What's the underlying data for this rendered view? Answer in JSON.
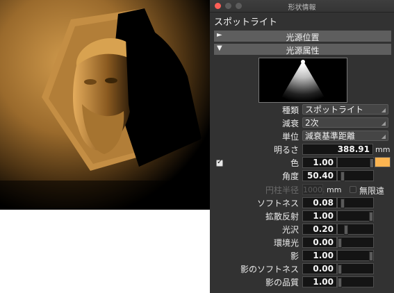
{
  "window": {
    "title": "形状情報"
  },
  "panel": {
    "heading": "スポットライト",
    "sections": [
      {
        "label": "光源位置",
        "state": "collapsed",
        "arrow": "►"
      },
      {
        "label": "光源属性",
        "state": "expanded",
        "arrow": "▼"
      }
    ]
  },
  "fields": {
    "type": {
      "label": "種類",
      "value": "スポットライト"
    },
    "attenuation": {
      "label": "減衰",
      "value": "2次"
    },
    "unit": {
      "label": "単位",
      "value": "減衰基準距離"
    },
    "brightness": {
      "label": "明るさ",
      "value": "388.91",
      "unit": "mm"
    },
    "color": {
      "label": "色",
      "value": "1.00",
      "checked": true,
      "swatch": "#fbb451"
    },
    "angle": {
      "label": "角度",
      "value": "50.40",
      "slider": 0.08
    },
    "cylinder_radius": {
      "label": "円柱半径",
      "value": "1000.",
      "unit": "mm",
      "infinite_label": "無限遠",
      "enabled": false
    },
    "softness": {
      "label": "ソフトネス",
      "value": "0.08",
      "slider": 0.08
    },
    "diffuse": {
      "label": "拡散反射",
      "value": "1.00",
      "slider": 1.0
    },
    "gloss": {
      "label": "光沢",
      "value": "0.20",
      "slider": 0.2
    },
    "ambient": {
      "label": "環境光",
      "value": "0.00",
      "slider": 0.0
    },
    "shadow": {
      "label": "影",
      "value": "1.00",
      "slider": 1.0
    },
    "shadow_softness": {
      "label": "影のソフトネス",
      "value": "0.00",
      "slider": 0.0
    },
    "shadow_quality": {
      "label": "影の品質",
      "value": "1.00",
      "slider": 0.0
    }
  },
  "colors": {
    "panel_bg": "#323232",
    "section_bg": "#5e5e5e",
    "accent_swatch": "#fbb451",
    "close_button": "#fe5f57"
  },
  "icons": [
    "close-icon",
    "minimize-icon",
    "zoom-icon",
    "disclosure-arrow-icon",
    "dropdown-caret-icon",
    "checkbox-icon"
  ]
}
